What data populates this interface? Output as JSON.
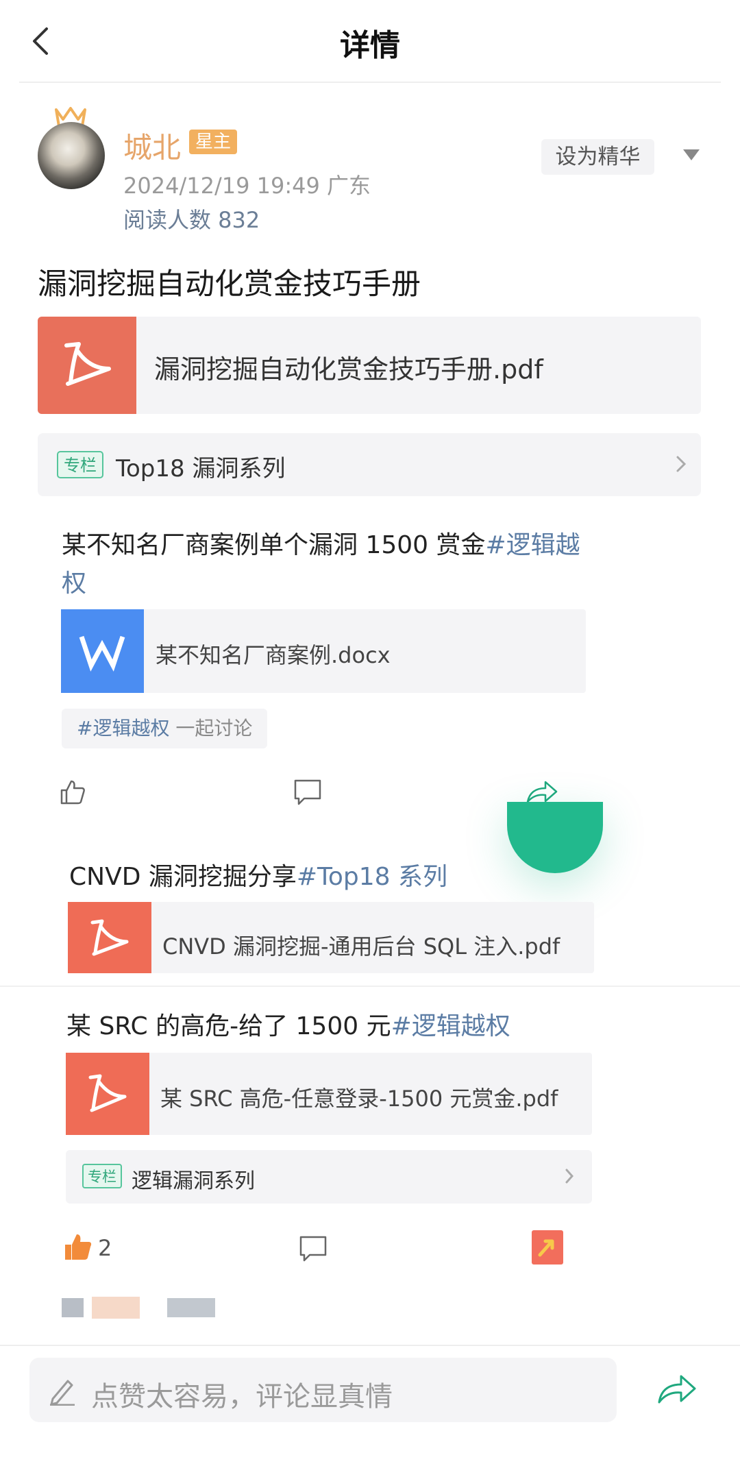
{
  "header": {
    "title": "详情"
  },
  "author": {
    "name": "城北",
    "badge": "星主",
    "time_location": "2024/12/19 19:49  广东",
    "read_count": "阅读人数 832",
    "essence_button": "设为精华"
  },
  "post": {
    "title": "漏洞挖掘自动化赏金技巧手册",
    "file_name": "漏洞挖掘自动化赏金技巧手册.pdf",
    "column_tag": "专栏",
    "column_label": "Top18 漏洞系列"
  },
  "embedded": {
    "item1": {
      "text": "某不知名厂商案例单个漏洞 1500 赏金",
      "tag_line1": "#逻辑越",
      "tag_line2": "权",
      "file_name": "某不知名厂商案例.docx",
      "discuss_tag": "#逻辑越权",
      "discuss_text": " 一起讨论"
    },
    "item2": {
      "text": "CNVD 漏洞挖掘分享",
      "tag": "#Top18 系列",
      "file_name": "CNVD 漏洞挖掘-通用后台 SQL 注入.pdf"
    },
    "item3": {
      "text": "某 SRC 的高危-给了 1500 元",
      "tag": "#逻辑越权",
      "file_name": "某 SRC 高危-任意登录-1500 元赏金.pdf",
      "column_tag": "专栏",
      "column_label": "逻辑漏洞系列",
      "like_count": "2"
    }
  },
  "bottom": {
    "comment_placeholder": "点赞太容易，评论显真情"
  },
  "colors": {
    "accent_green": "#22b98d",
    "pdf_red": "#e8705b",
    "word_blue": "#4b8df2",
    "link_blue": "#5b7ca4",
    "star_orange": "#f2b05f"
  }
}
